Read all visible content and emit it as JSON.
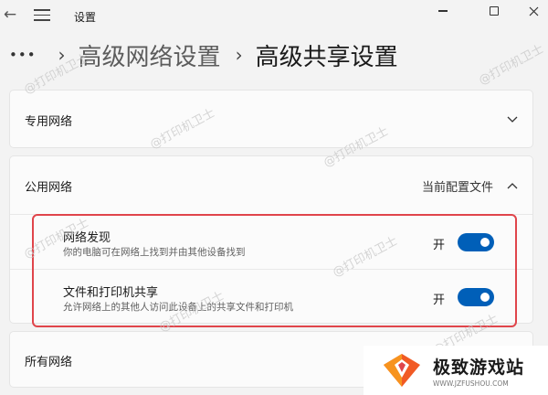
{
  "window": {
    "title": "设置"
  },
  "breadcrumb": {
    "more": "•••",
    "separator": "›",
    "parent": "高级网络设置",
    "current": "高级共享设置"
  },
  "sections": {
    "private": {
      "label": "专用网络",
      "expanded": false
    },
    "public": {
      "label": "公用网络",
      "expanded": true,
      "badge": "当前配置文件",
      "settings": [
        {
          "title": "网络发现",
          "description": "你的电脑可在网络上找到并由其他设备找到",
          "toggle_label": "开",
          "on": true
        },
        {
          "title": "文件和打印机共享",
          "description": "允许网络上的其他人访问此设备上的共享文件和打印机",
          "toggle_label": "开",
          "on": true
        }
      ]
    },
    "all": {
      "label": "所有网络"
    }
  },
  "watermark_text": "@打印机卫士",
  "brand": {
    "name": "极致游戏站",
    "url": "WWW.JZFUSHOU.COM"
  },
  "colors": {
    "toggle_on": "#005fb8",
    "highlight_border": "#e0454b",
    "background": "#f3f3f3"
  }
}
